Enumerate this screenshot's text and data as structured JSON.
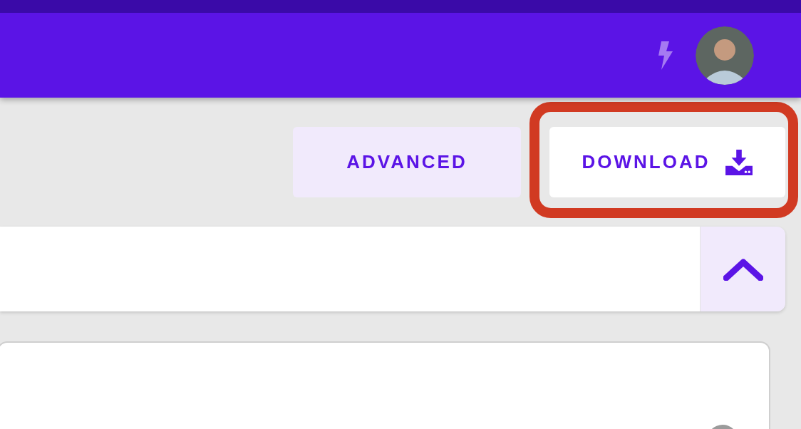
{
  "buttons": [
    {
      "label": "ADVANCED",
      "kind": "tinted",
      "highlighted": false
    },
    {
      "label": "DOWNLOAD",
      "kind": "download",
      "highlighted": true
    }
  ],
  "search": {
    "expanded": true
  }
}
